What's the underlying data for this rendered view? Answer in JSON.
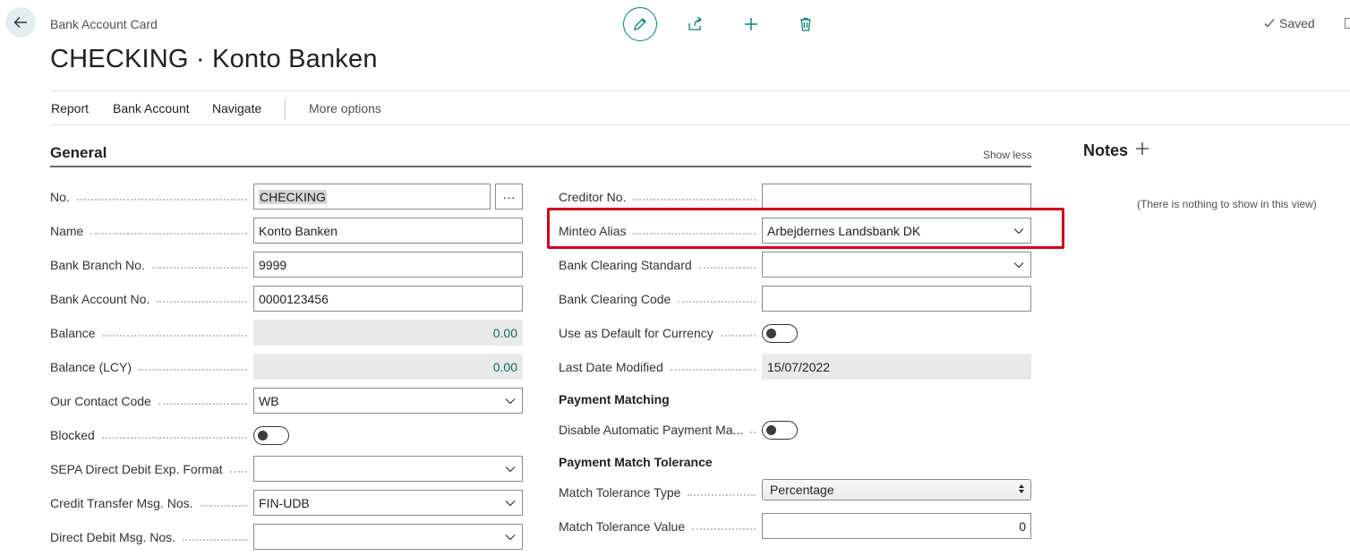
{
  "header": {
    "breadcrumb": "Bank Account Card",
    "title": "CHECKING · Konto Banken",
    "saved_label": "Saved"
  },
  "actions": {
    "report": "Report",
    "bank_account": "Bank Account",
    "navigate": "Navigate",
    "more_options": "More options"
  },
  "general": {
    "title": "General",
    "show_less": "Show less",
    "left": {
      "no_label": "No.",
      "no_value_highlight": "CHECKING",
      "assist_label": "···",
      "name_label": "Name",
      "name_value": "Konto Banken",
      "branch_label": "Bank Branch No.",
      "branch_value": "9999",
      "account_label": "Bank Account No.",
      "account_value": "0000123456",
      "balance_label": "Balance",
      "balance_value": "0.00",
      "balance_lcy_label": "Balance (LCY)",
      "balance_lcy_value": "0.00",
      "contact_label": "Our Contact Code",
      "contact_value": "WB",
      "blocked_label": "Blocked",
      "sepa_label": "SEPA Direct Debit Exp. Format",
      "sepa_value": "",
      "credit_label": "Credit Transfer Msg. Nos.",
      "credit_value": "FIN-UDB",
      "debit_label": "Direct Debit Msg. Nos.",
      "debit_value": ""
    },
    "right": {
      "creditor_label": "Creditor No.",
      "creditor_value": "",
      "minteo_label": "Minteo Alias",
      "minteo_value": "Arbejdernes Landsbank DK",
      "clearing_std_label": "Bank Clearing Standard",
      "clearing_std_value": "",
      "clearing_code_label": "Bank Clearing Code",
      "clearing_code_value": "",
      "default_currency_label": "Use as Default for Currency",
      "last_modified_label": "Last Date Modified",
      "last_modified_value": "15/07/2022",
      "payment_matching_heading": "Payment Matching",
      "disable_auto_label": "Disable Automatic Payment Ma...",
      "tolerance_heading": "Payment Match Tolerance",
      "tolerance_type_label": "Match Tolerance Type",
      "tolerance_type_value": "Percentage",
      "tolerance_value_label": "Match Tolerance Value",
      "tolerance_value": "0"
    }
  },
  "notes": {
    "title": "Notes",
    "empty": "(There is nothing to show in this view)"
  },
  "colors": {
    "accent": "#00847a",
    "highlight_box": "#d0021b"
  }
}
